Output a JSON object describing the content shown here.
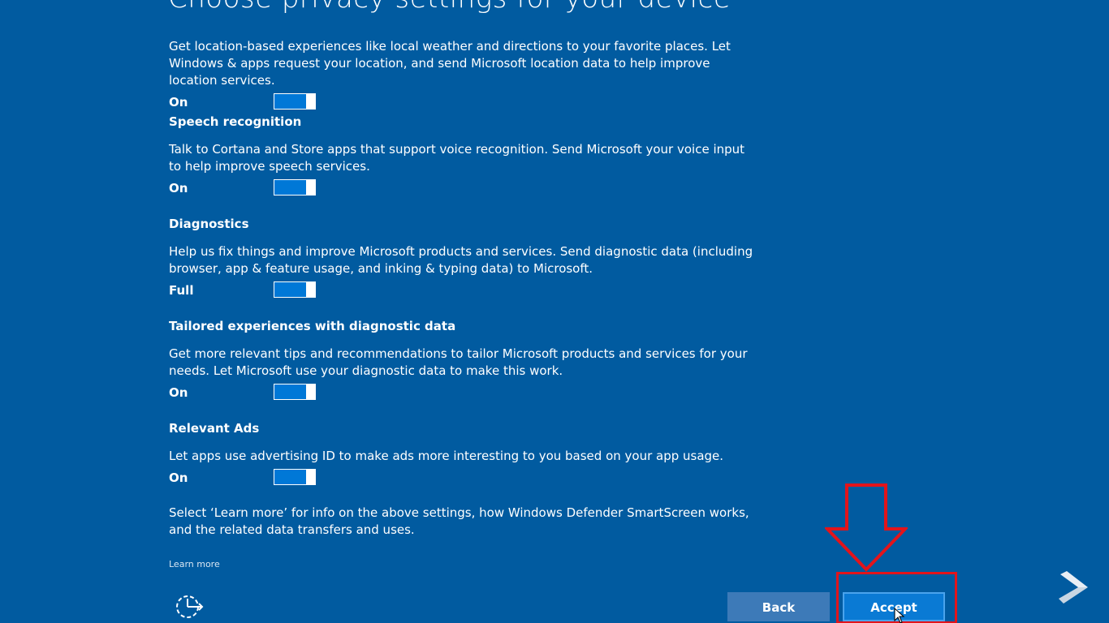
{
  "page": {
    "title": "Choose privacy settings for your device"
  },
  "settings": [
    {
      "heading": "",
      "description": "Get location-based experiences like local weather and directions to your favorite places. Let Windows & apps request your location, and send Microsoft location data to help improve location services.",
      "state_label": "On",
      "enabled": true
    },
    {
      "heading": "Speech recognition",
      "description": "Talk to Cortana and Store apps that support voice recognition. Send Microsoft your voice input to help improve speech services.",
      "state_label": "On",
      "enabled": true
    },
    {
      "heading": "Diagnostics",
      "description": "Help us fix things and improve Microsoft products and services. Send diagnostic data (including browser, app & feature usage, and inking & typing data) to Microsoft.",
      "state_label": "Full",
      "enabled": true
    },
    {
      "heading": "Tailored experiences with diagnostic data",
      "description": "Get more relevant tips and recommendations to tailor Microsoft products and services for your needs. Let Microsoft use your diagnostic data to make this work.",
      "state_label": "On",
      "enabled": true
    },
    {
      "heading": "Relevant Ads",
      "description": "Let apps use advertising ID to make ads more interesting to you based on your app usage.",
      "state_label": "On",
      "enabled": true
    }
  ],
  "footer": {
    "info_text": "Select ‘Learn more’ for info on the above settings, how Windows Defender SmartScreen works, and the related data transfers and uses.",
    "learn_more": "Learn more"
  },
  "buttons": {
    "back": "Back",
    "accept": "Accept"
  },
  "icons": {
    "ease_of_access": "ease-of-access-icon",
    "corner_logo": "chevron-logo-icon"
  },
  "colors": {
    "background": "#015ba0",
    "toggle_on": "#0078d7",
    "highlight": "#e3141b"
  }
}
